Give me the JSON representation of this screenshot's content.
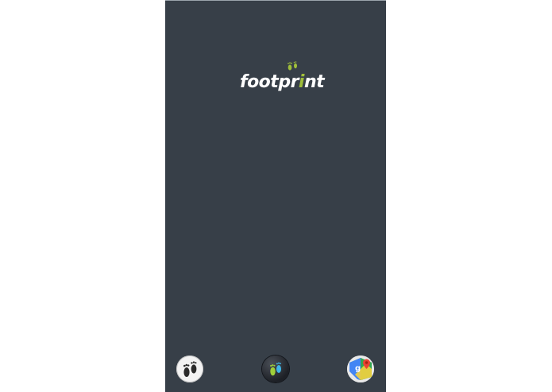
{
  "app": {
    "logo_text_prefix": "footpr",
    "logo_text_i": "i",
    "logo_text_suffix": "nt"
  },
  "dock": {
    "items": [
      {
        "icon": "footprints-icon"
      },
      {
        "icon": "footprint-tracker-icon"
      },
      {
        "icon": "google-maps-icon"
      }
    ]
  },
  "colors": {
    "screen_background": "#373f48",
    "logo_accent": "#9fbe3a",
    "page_background": "#ffffff"
  }
}
